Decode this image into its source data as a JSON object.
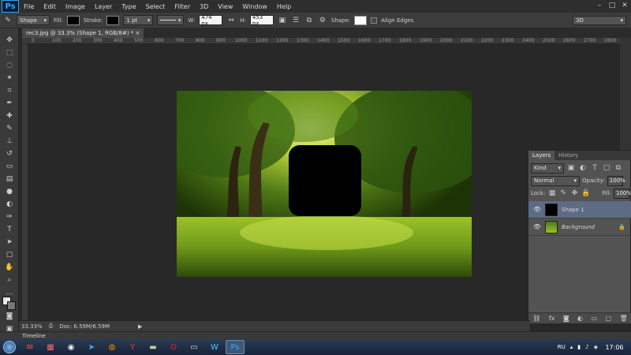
{
  "app": {
    "logo": "Ps"
  },
  "menu": [
    "File",
    "Edit",
    "Image",
    "Layer",
    "Type",
    "Select",
    "Filter",
    "3D",
    "View",
    "Window",
    "Help"
  ],
  "window_controls": {
    "minimize": "–",
    "maximize": "□",
    "close": "✕"
  },
  "options": {
    "mode": "Shape",
    "fill_label": "Fill:",
    "stroke_label": "Stroke:",
    "stroke_width": "1 pt",
    "w_label": "W:",
    "w_value": "474 px",
    "h_label": "H:",
    "h_value": "453 px",
    "shape_label": "Shape:",
    "align_edges": "Align Edges",
    "workspace": "3D",
    "colors": {
      "fill": "#000000",
      "stroke": "#000000",
      "shape": "#ffffff"
    }
  },
  "document": {
    "tab_title": "rec3.jpg @ 33.3% (Shape 1, RGB/8#) *",
    "close": "×"
  },
  "ruler": [
    "0",
    "100",
    "200",
    "300",
    "400",
    "500",
    "600",
    "700",
    "800",
    "900",
    "1000",
    "1100",
    "1200",
    "1300",
    "1400",
    "1500",
    "1600",
    "1700",
    "1800",
    "1900",
    "2000",
    "2100",
    "2200",
    "2300",
    "2400",
    "2500",
    "2600",
    "2700",
    "2800"
  ],
  "status": {
    "zoom": "33.33%",
    "doc": "Doc: 6.59M/6.59M"
  },
  "timeline": "Timeline",
  "layers_panel": {
    "tabs": [
      "Layers",
      "History"
    ],
    "filter": "Kind",
    "blend_mode": "Normal",
    "opacity_label": "Opacity:",
    "opacity": "100%",
    "lock_label": "Lock:",
    "fill_label": "Fill:",
    "fill": "100%",
    "layers": [
      {
        "name": "Shape 1",
        "selected": true
      },
      {
        "name": "Background",
        "selected": false
      }
    ]
  },
  "taskbar": {
    "lang": "RU",
    "clock": "17:06"
  }
}
